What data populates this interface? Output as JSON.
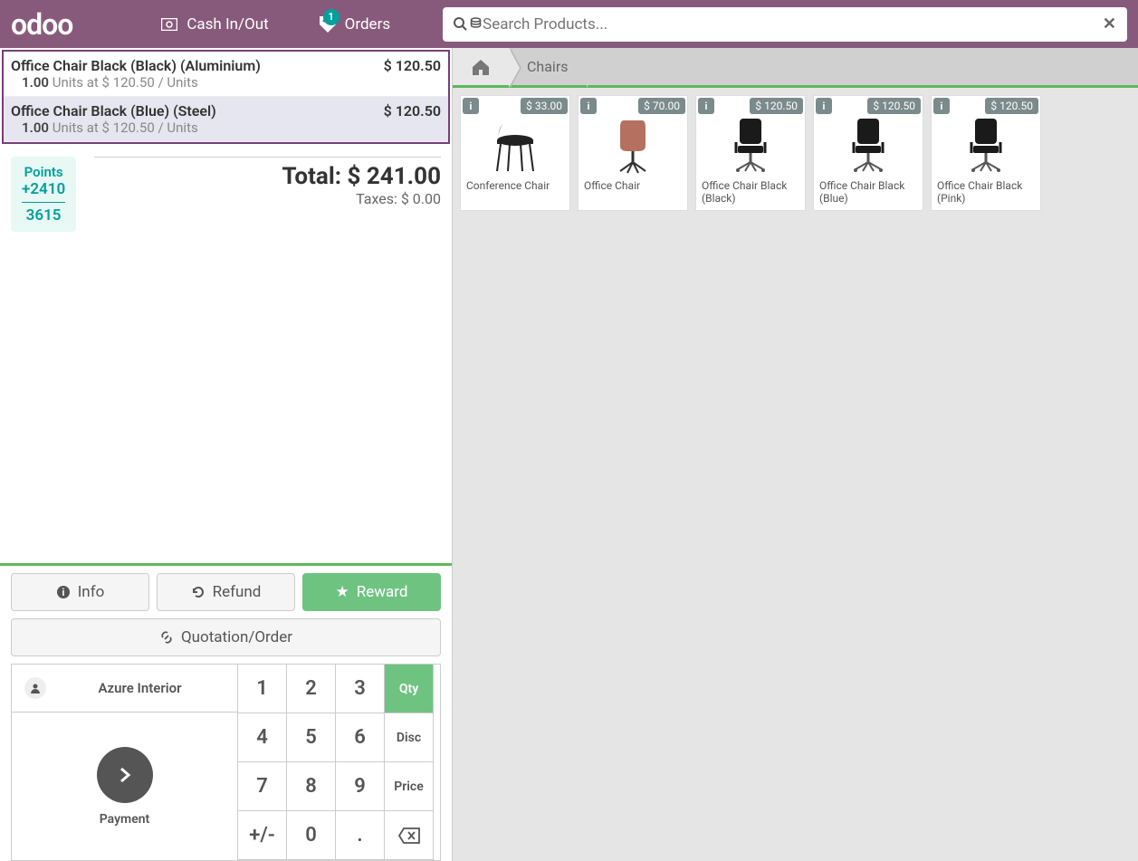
{
  "header": {
    "logo": "odoo",
    "cashInOut": "Cash In/Out",
    "orders": "Orders",
    "ordersBadge": "1",
    "searchPlaceholder": "Search Products..."
  },
  "orderLines": [
    {
      "name": "Office Chair Black (Black) (Aluminium)",
      "price": "$ 120.50",
      "qty": "1.00",
      "sub": "Units at $ 120.50 / Units",
      "selected": false
    },
    {
      "name": "Office Chair Black (Blue) (Steel)",
      "price": "$ 120.50",
      "qty": "1.00",
      "sub": "Units at $ 120.50 / Units",
      "selected": true
    }
  ],
  "points": {
    "label": "Points",
    "gain": "+2410",
    "balance": "3615"
  },
  "totals": {
    "total": "Total: $ 241.00",
    "taxes": "Taxes: $ 0.00"
  },
  "actions": {
    "info": "Info",
    "refund": "Refund",
    "reward": "Reward",
    "quotation": "Quotation/Order"
  },
  "customer": "Azure Interior",
  "payment": "Payment",
  "keypad": {
    "n1": "1",
    "n2": "2",
    "n3": "3",
    "n4": "4",
    "n5": "5",
    "n6": "6",
    "n7": "7",
    "n8": "8",
    "n9": "9",
    "pm": "+/-",
    "n0": "0",
    "dot": ".",
    "qty": "Qty",
    "disc": "Disc",
    "price": "Price",
    "bs": "⌫"
  },
  "breadcrumb": {
    "home": "🏠",
    "category": "Chairs"
  },
  "products": [
    {
      "name": "Conference Chair",
      "price": "$ 33.00",
      "kind": "conference"
    },
    {
      "name": "Office Chair",
      "price": "$ 70.00",
      "kind": "brown"
    },
    {
      "name": "Office Chair Black (Black)",
      "price": "$ 120.50",
      "kind": "black"
    },
    {
      "name": "Office Chair Black (Blue)",
      "price": "$ 120.50",
      "kind": "black"
    },
    {
      "name": "Office Chair Black (Pink)",
      "price": "$ 120.50",
      "kind": "black"
    }
  ]
}
